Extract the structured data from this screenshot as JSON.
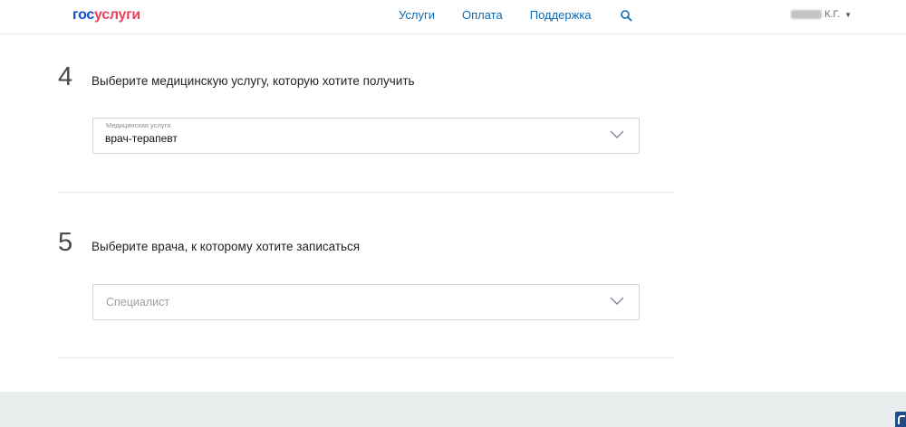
{
  "header": {
    "logo": {
      "part1": "гос",
      "part2": "услуги"
    },
    "nav": [
      {
        "label": "Услуги"
      },
      {
        "label": "Оплата"
      },
      {
        "label": "Поддержка"
      }
    ],
    "user": {
      "initials": "К.Г."
    }
  },
  "steps": [
    {
      "number": "4",
      "title": "Выберите медицинскую услугу, которую хотите получить",
      "select": {
        "label": "Медицинская услуга",
        "value": "врач-терапевт"
      }
    },
    {
      "number": "5",
      "title": "Выберите врача, к которому хотите записаться",
      "select": {
        "placeholder": "Специалист"
      }
    }
  ],
  "colors": {
    "logo_blue": "#0d4cd3",
    "logo_red": "#ee3f58",
    "link": "#0d6ab5",
    "footer_bg": "#e9eded"
  }
}
